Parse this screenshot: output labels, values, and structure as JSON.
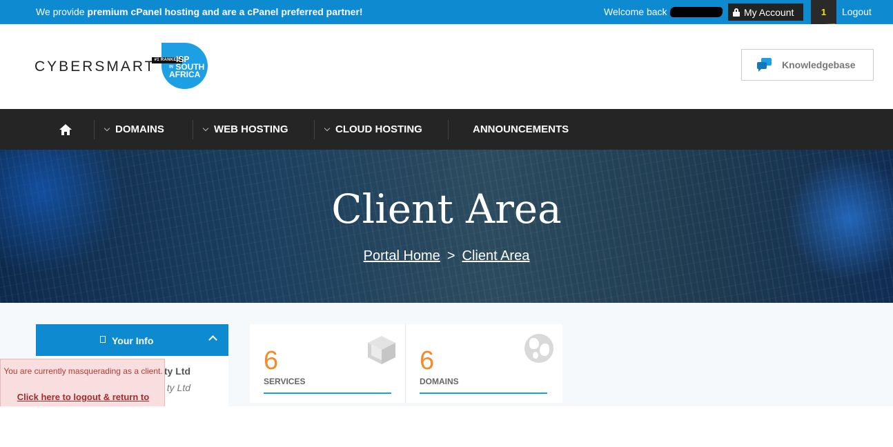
{
  "topbar": {
    "promo_prefix": "We provide ",
    "promo_bold": "premium cPanel hosting and are a cPanel preferred partner!",
    "welcome": "Welcome back",
    "my_account": "My Account",
    "notification_count": "1",
    "logout": "Logout"
  },
  "header": {
    "logo_text": "CYBERSMART",
    "badge_tag": "#1 RANKED",
    "badge_line1": "ISP",
    "badge_in": "IN",
    "badge_line2": "SOUTH",
    "badge_line3": "AFRICA",
    "knowledgebase": "Knowledgebase"
  },
  "nav": {
    "items": [
      {
        "label": "DOMAINS"
      },
      {
        "label": "WEB HOSTING"
      },
      {
        "label": "CLOUD HOSTING"
      },
      {
        "label": "ANNOUNCEMENTS"
      }
    ]
  },
  "hero": {
    "title": "Client Area",
    "breadcrumb_home": "Portal Home",
    "breadcrumb_sep": ">",
    "breadcrumb_current": "Client Area"
  },
  "sidebar": {
    "panel_title": "Your Info",
    "company_line1": "ty Ltd",
    "company_line2": "ty Ltd"
  },
  "masquerade": {
    "message": "You are currently masquerading as a client.",
    "link": "Click here to logout & return to"
  },
  "stats": [
    {
      "value": "6",
      "label": "SERVICES",
      "icon": "cube-icon"
    },
    {
      "value": "6",
      "label": "DOMAINS",
      "icon": "globe-icon"
    }
  ],
  "colors": {
    "brand_blue": "#0e8bd0",
    "nav_dark": "#252525",
    "stat_orange": "#f28b2c",
    "highlight": "#ffff00"
  }
}
